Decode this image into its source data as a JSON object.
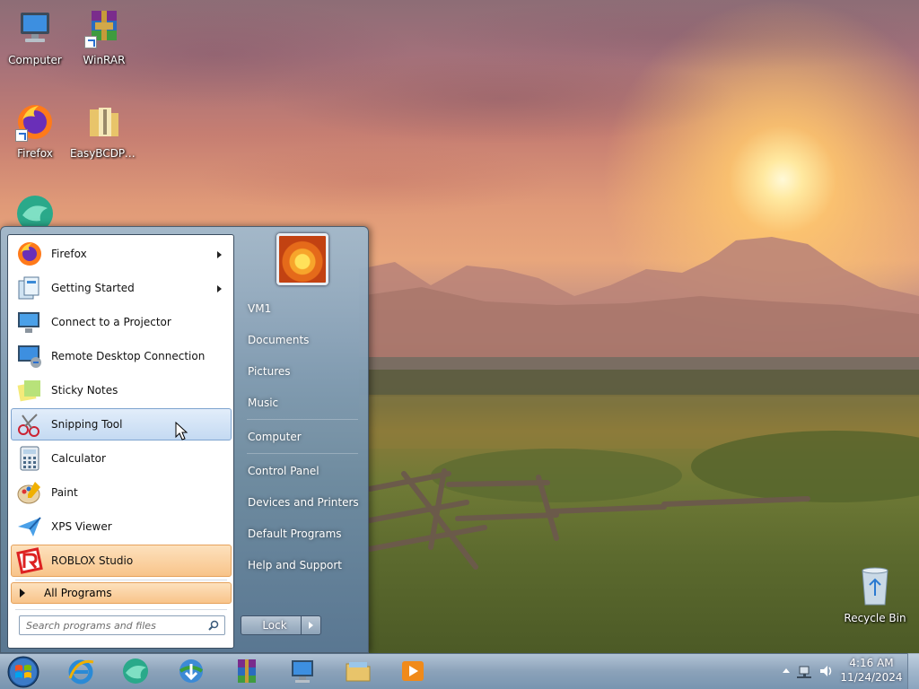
{
  "desktop": {
    "icons": [
      {
        "label": "Computer"
      },
      {
        "label": "WinRAR"
      },
      {
        "label": "Firefox"
      },
      {
        "label": "EasyBCDPor..."
      },
      {
        "label": "Recycle Bin"
      }
    ]
  },
  "start_menu": {
    "programs": [
      {
        "label": "Firefox",
        "has_submenu": true
      },
      {
        "label": "Getting Started",
        "has_submenu": true
      },
      {
        "label": "Connect to a Projector",
        "has_submenu": false
      },
      {
        "label": "Remote Desktop Connection",
        "has_submenu": false
      },
      {
        "label": "Sticky Notes",
        "has_submenu": false
      },
      {
        "label": "Snipping Tool",
        "has_submenu": false,
        "highlighted": true
      },
      {
        "label": "Calculator",
        "has_submenu": false
      },
      {
        "label": "Paint",
        "has_submenu": false
      },
      {
        "label": "XPS Viewer",
        "has_submenu": false
      },
      {
        "label": "ROBLOX Studio",
        "has_submenu": false,
        "pinned_highlight": true
      }
    ],
    "all_programs_label": "All Programs",
    "search_placeholder": "Search programs and files",
    "right_items": [
      {
        "label": "VM1"
      },
      {
        "label": "Documents"
      },
      {
        "label": "Pictures"
      },
      {
        "label": "Music"
      },
      {
        "label": "Computer"
      },
      {
        "label": "Control Panel"
      },
      {
        "label": "Devices and Printers"
      },
      {
        "label": "Default Programs"
      },
      {
        "label": "Help and Support"
      }
    ],
    "lock_label": "Lock"
  },
  "taskbar": {
    "pinned": [
      {
        "icon": "internet-explorer-icon"
      },
      {
        "icon": "app-swirl-icon"
      },
      {
        "icon": "download-manager-icon"
      },
      {
        "icon": "winrar-icon"
      },
      {
        "icon": "remote-desktop-icon"
      },
      {
        "icon": "file-explorer-icon"
      },
      {
        "icon": "media-player-icon"
      }
    ],
    "clock": {
      "time": "4:16 AM",
      "date": "11/24/2024"
    }
  },
  "colors": {
    "selection_blue": "#c4daf2",
    "pinned_orange": "#f8c48a",
    "menu_glass": "#6e8ca5"
  }
}
